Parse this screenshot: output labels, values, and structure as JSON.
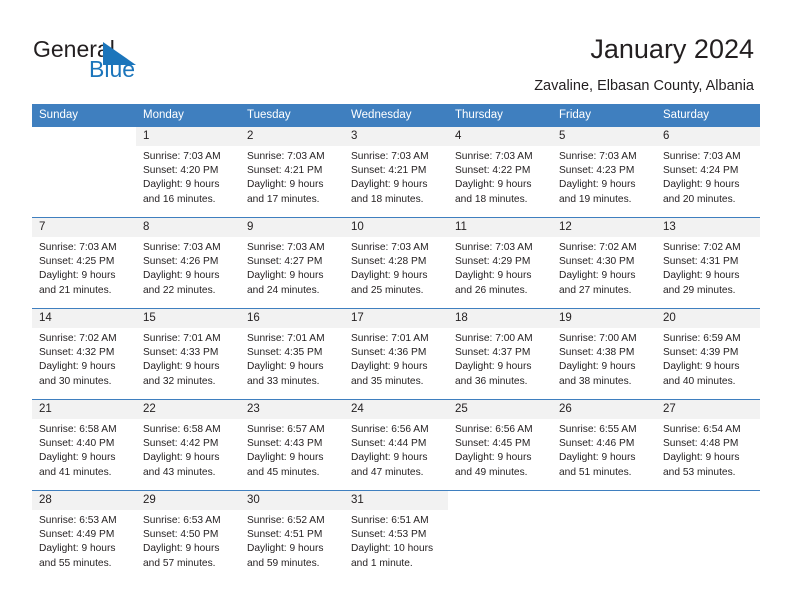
{
  "brand": {
    "name_part1": "General",
    "name_part2": "Blue",
    "accent_color": "#1b75bb"
  },
  "header": {
    "title": "January 2024",
    "location": "Zavaline, Elbasan County, Albania"
  },
  "calendar": {
    "header_bg": "#3f7fbf",
    "weekday_headers": [
      "Sunday",
      "Monday",
      "Tuesday",
      "Wednesday",
      "Thursday",
      "Friday",
      "Saturday"
    ],
    "weeks": [
      [
        {
          "day": "",
          "sunrise": "",
          "sunset": "",
          "daylight1": "",
          "daylight2": ""
        },
        {
          "day": "1",
          "sunrise": "Sunrise: 7:03 AM",
          "sunset": "Sunset: 4:20 PM",
          "daylight1": "Daylight: 9 hours",
          "daylight2": "and 16 minutes."
        },
        {
          "day": "2",
          "sunrise": "Sunrise: 7:03 AM",
          "sunset": "Sunset: 4:21 PM",
          "daylight1": "Daylight: 9 hours",
          "daylight2": "and 17 minutes."
        },
        {
          "day": "3",
          "sunrise": "Sunrise: 7:03 AM",
          "sunset": "Sunset: 4:21 PM",
          "daylight1": "Daylight: 9 hours",
          "daylight2": "and 18 minutes."
        },
        {
          "day": "4",
          "sunrise": "Sunrise: 7:03 AM",
          "sunset": "Sunset: 4:22 PM",
          "daylight1": "Daylight: 9 hours",
          "daylight2": "and 18 minutes."
        },
        {
          "day": "5",
          "sunrise": "Sunrise: 7:03 AM",
          "sunset": "Sunset: 4:23 PM",
          "daylight1": "Daylight: 9 hours",
          "daylight2": "and 19 minutes."
        },
        {
          "day": "6",
          "sunrise": "Sunrise: 7:03 AM",
          "sunset": "Sunset: 4:24 PM",
          "daylight1": "Daylight: 9 hours",
          "daylight2": "and 20 minutes."
        }
      ],
      [
        {
          "day": "7",
          "sunrise": "Sunrise: 7:03 AM",
          "sunset": "Sunset: 4:25 PM",
          "daylight1": "Daylight: 9 hours",
          "daylight2": "and 21 minutes."
        },
        {
          "day": "8",
          "sunrise": "Sunrise: 7:03 AM",
          "sunset": "Sunset: 4:26 PM",
          "daylight1": "Daylight: 9 hours",
          "daylight2": "and 22 minutes."
        },
        {
          "day": "9",
          "sunrise": "Sunrise: 7:03 AM",
          "sunset": "Sunset: 4:27 PM",
          "daylight1": "Daylight: 9 hours",
          "daylight2": "and 24 minutes."
        },
        {
          "day": "10",
          "sunrise": "Sunrise: 7:03 AM",
          "sunset": "Sunset: 4:28 PM",
          "daylight1": "Daylight: 9 hours",
          "daylight2": "and 25 minutes."
        },
        {
          "day": "11",
          "sunrise": "Sunrise: 7:03 AM",
          "sunset": "Sunset: 4:29 PM",
          "daylight1": "Daylight: 9 hours",
          "daylight2": "and 26 minutes."
        },
        {
          "day": "12",
          "sunrise": "Sunrise: 7:02 AM",
          "sunset": "Sunset: 4:30 PM",
          "daylight1": "Daylight: 9 hours",
          "daylight2": "and 27 minutes."
        },
        {
          "day": "13",
          "sunrise": "Sunrise: 7:02 AM",
          "sunset": "Sunset: 4:31 PM",
          "daylight1": "Daylight: 9 hours",
          "daylight2": "and 29 minutes."
        }
      ],
      [
        {
          "day": "14",
          "sunrise": "Sunrise: 7:02 AM",
          "sunset": "Sunset: 4:32 PM",
          "daylight1": "Daylight: 9 hours",
          "daylight2": "and 30 minutes."
        },
        {
          "day": "15",
          "sunrise": "Sunrise: 7:01 AM",
          "sunset": "Sunset: 4:33 PM",
          "daylight1": "Daylight: 9 hours",
          "daylight2": "and 32 minutes."
        },
        {
          "day": "16",
          "sunrise": "Sunrise: 7:01 AM",
          "sunset": "Sunset: 4:35 PM",
          "daylight1": "Daylight: 9 hours",
          "daylight2": "and 33 minutes."
        },
        {
          "day": "17",
          "sunrise": "Sunrise: 7:01 AM",
          "sunset": "Sunset: 4:36 PM",
          "daylight1": "Daylight: 9 hours",
          "daylight2": "and 35 minutes."
        },
        {
          "day": "18",
          "sunrise": "Sunrise: 7:00 AM",
          "sunset": "Sunset: 4:37 PM",
          "daylight1": "Daylight: 9 hours",
          "daylight2": "and 36 minutes."
        },
        {
          "day": "19",
          "sunrise": "Sunrise: 7:00 AM",
          "sunset": "Sunset: 4:38 PM",
          "daylight1": "Daylight: 9 hours",
          "daylight2": "and 38 minutes."
        },
        {
          "day": "20",
          "sunrise": "Sunrise: 6:59 AM",
          "sunset": "Sunset: 4:39 PM",
          "daylight1": "Daylight: 9 hours",
          "daylight2": "and 40 minutes."
        }
      ],
      [
        {
          "day": "21",
          "sunrise": "Sunrise: 6:58 AM",
          "sunset": "Sunset: 4:40 PM",
          "daylight1": "Daylight: 9 hours",
          "daylight2": "and 41 minutes."
        },
        {
          "day": "22",
          "sunrise": "Sunrise: 6:58 AM",
          "sunset": "Sunset: 4:42 PM",
          "daylight1": "Daylight: 9 hours",
          "daylight2": "and 43 minutes."
        },
        {
          "day": "23",
          "sunrise": "Sunrise: 6:57 AM",
          "sunset": "Sunset: 4:43 PM",
          "daylight1": "Daylight: 9 hours",
          "daylight2": "and 45 minutes."
        },
        {
          "day": "24",
          "sunrise": "Sunrise: 6:56 AM",
          "sunset": "Sunset: 4:44 PM",
          "daylight1": "Daylight: 9 hours",
          "daylight2": "and 47 minutes."
        },
        {
          "day": "25",
          "sunrise": "Sunrise: 6:56 AM",
          "sunset": "Sunset: 4:45 PM",
          "daylight1": "Daylight: 9 hours",
          "daylight2": "and 49 minutes."
        },
        {
          "day": "26",
          "sunrise": "Sunrise: 6:55 AM",
          "sunset": "Sunset: 4:46 PM",
          "daylight1": "Daylight: 9 hours",
          "daylight2": "and 51 minutes."
        },
        {
          "day": "27",
          "sunrise": "Sunrise: 6:54 AM",
          "sunset": "Sunset: 4:48 PM",
          "daylight1": "Daylight: 9 hours",
          "daylight2": "and 53 minutes."
        }
      ],
      [
        {
          "day": "28",
          "sunrise": "Sunrise: 6:53 AM",
          "sunset": "Sunset: 4:49 PM",
          "daylight1": "Daylight: 9 hours",
          "daylight2": "and 55 minutes."
        },
        {
          "day": "29",
          "sunrise": "Sunrise: 6:53 AM",
          "sunset": "Sunset: 4:50 PM",
          "daylight1": "Daylight: 9 hours",
          "daylight2": "and 57 minutes."
        },
        {
          "day": "30",
          "sunrise": "Sunrise: 6:52 AM",
          "sunset": "Sunset: 4:51 PM",
          "daylight1": "Daylight: 9 hours",
          "daylight2": "and 59 minutes."
        },
        {
          "day": "31",
          "sunrise": "Sunrise: 6:51 AM",
          "sunset": "Sunset: 4:53 PM",
          "daylight1": "Daylight: 10 hours",
          "daylight2": "and 1 minute."
        },
        {
          "day": "",
          "sunrise": "",
          "sunset": "",
          "daylight1": "",
          "daylight2": ""
        },
        {
          "day": "",
          "sunrise": "",
          "sunset": "",
          "daylight1": "",
          "daylight2": ""
        },
        {
          "day": "",
          "sunrise": "",
          "sunset": "",
          "daylight1": "",
          "daylight2": ""
        }
      ]
    ]
  }
}
